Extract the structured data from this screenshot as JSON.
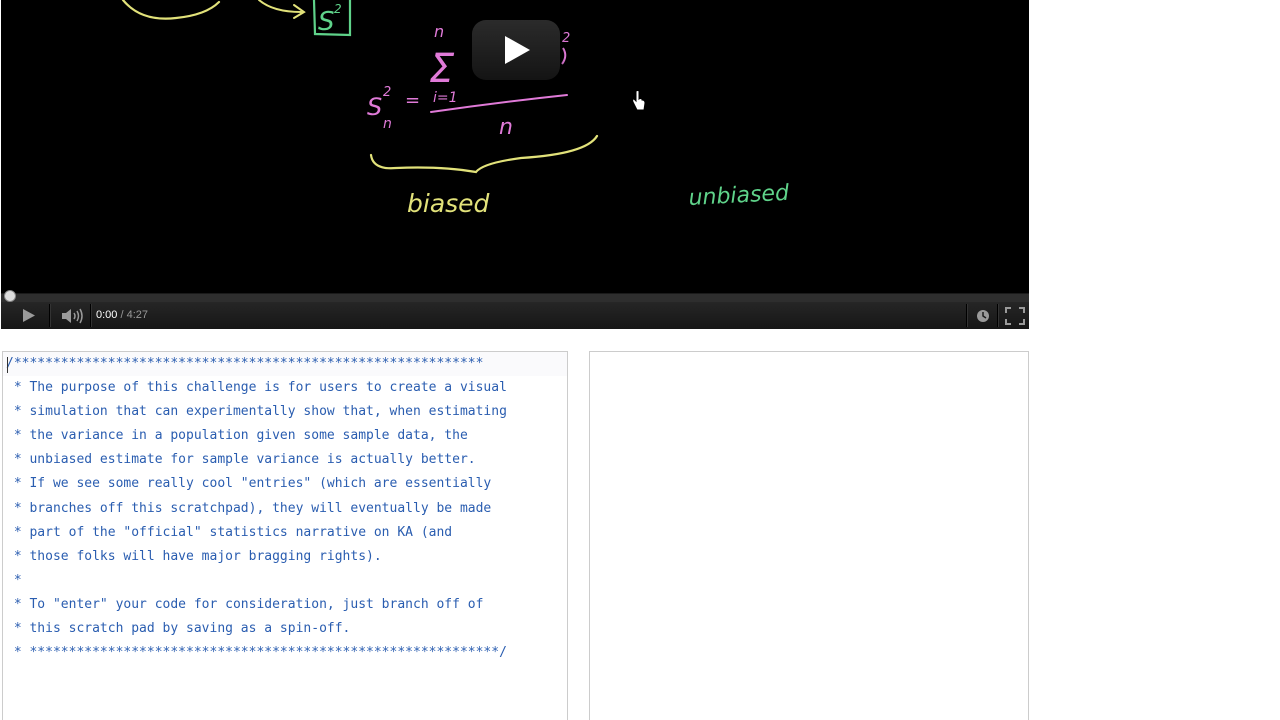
{
  "video": {
    "board": {
      "s2_label": "S",
      "s2_sup": "2",
      "sum_top": "n",
      "sum_symbol": "Σ",
      "sum_index": "i=1",
      "lhs": "S",
      "lhs_sup": "2",
      "lhs_sub": "n",
      "equals": "=",
      "denominator": "n",
      "power": "2",
      "biased_label": "biased",
      "unbiased_label": "unbiased"
    },
    "player": {
      "current_time": "0:00",
      "separator": " / ",
      "duration": "4:27",
      "progress": 0
    }
  },
  "editor": {
    "code": "/************************************************************\n * The purpose of this challenge is for users to create a visual\n * simulation that can experimentally show that, when estimating\n * the variance in a population given some sample data, the\n * unbiased estimate for sample variance is actually better.\n * If we see some really cool \"entries\" (which are essentially\n * branches off this scratchpad), they will eventually be made\n * part of the \"official\" statistics narrative on KA (and\n * those folks will have major bragging rights).\n *\n * To \"enter\" your code for consideration, just branch off of\n * this scratch pad by saving as a spin-off.\n * ************************************************************/"
  },
  "colors": {
    "chalk_yellow": "#e2e27a",
    "chalk_pink": "#e07ad8",
    "chalk_green": "#5fd38a",
    "code_blue": "#2a5db0"
  },
  "icons": [
    "play-icon",
    "volume-icon",
    "watch-later-icon",
    "fullscreen-icon",
    "hand-cursor-icon"
  ]
}
